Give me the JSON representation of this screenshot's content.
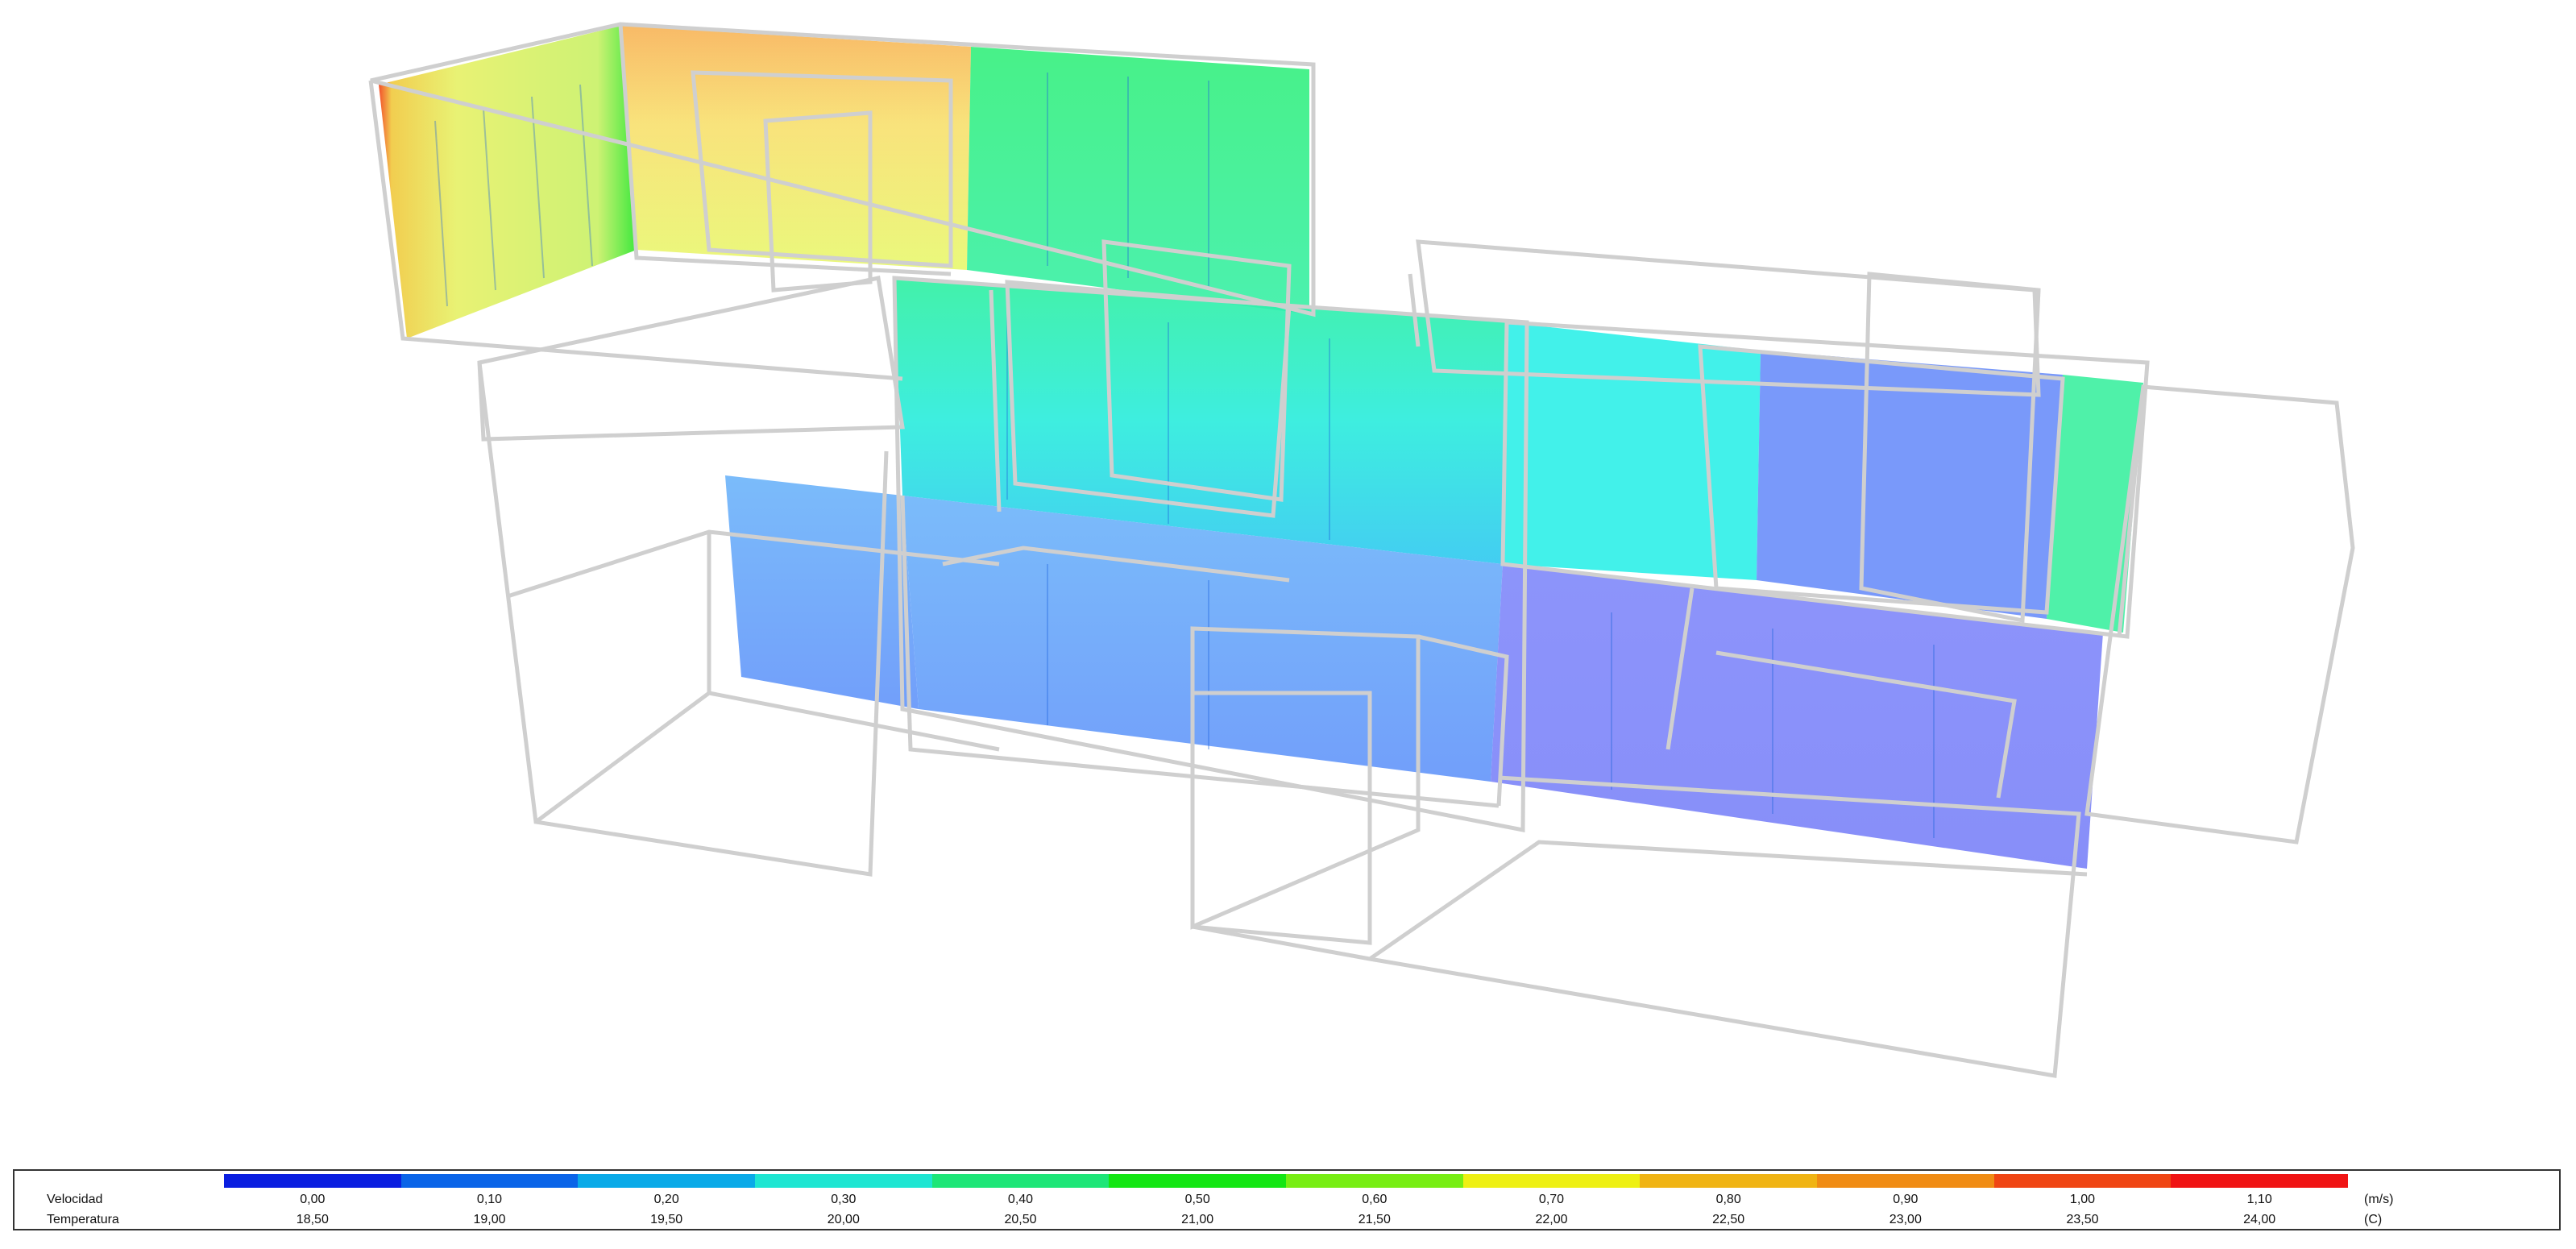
{
  "scene": {
    "panel_colors": {
      "hot_panel": "#e8f05a",
      "warm_panel": "#f6d872",
      "green_panel": "#3ef08a",
      "cyan_panel": "#2ee6e0",
      "blue_panel": "#5aa0f8",
      "violet_panel": "#6e7cf8"
    },
    "wireframe_color": "#cfcfcf"
  },
  "legend": {
    "velocity_label": "Velocidad",
    "temperature_label": "Temperatura",
    "velocity_unit": "(m/s)",
    "temperature_unit": "(C)",
    "colors": [
      "#0a1ee0",
      "#0a64e8",
      "#0aaae8",
      "#1ee6d2",
      "#1ee678",
      "#14e614",
      "#78ee14",
      "#eef014",
      "#f0b414",
      "#f08c14",
      "#f04614",
      "#f01414"
    ],
    "velocity_ticks": [
      "0,00",
      "0,10",
      "0,20",
      "0,30",
      "0,40",
      "0,50",
      "0,60",
      "0,70",
      "0,80",
      "0,90",
      "1,00",
      "1,10"
    ],
    "temperature_ticks": [
      "18,50",
      "19,00",
      "19,50",
      "20,00",
      "20,50",
      "21,00",
      "21,50",
      "22,00",
      "22,50",
      "23,00",
      "23,50",
      "24,00"
    ]
  }
}
